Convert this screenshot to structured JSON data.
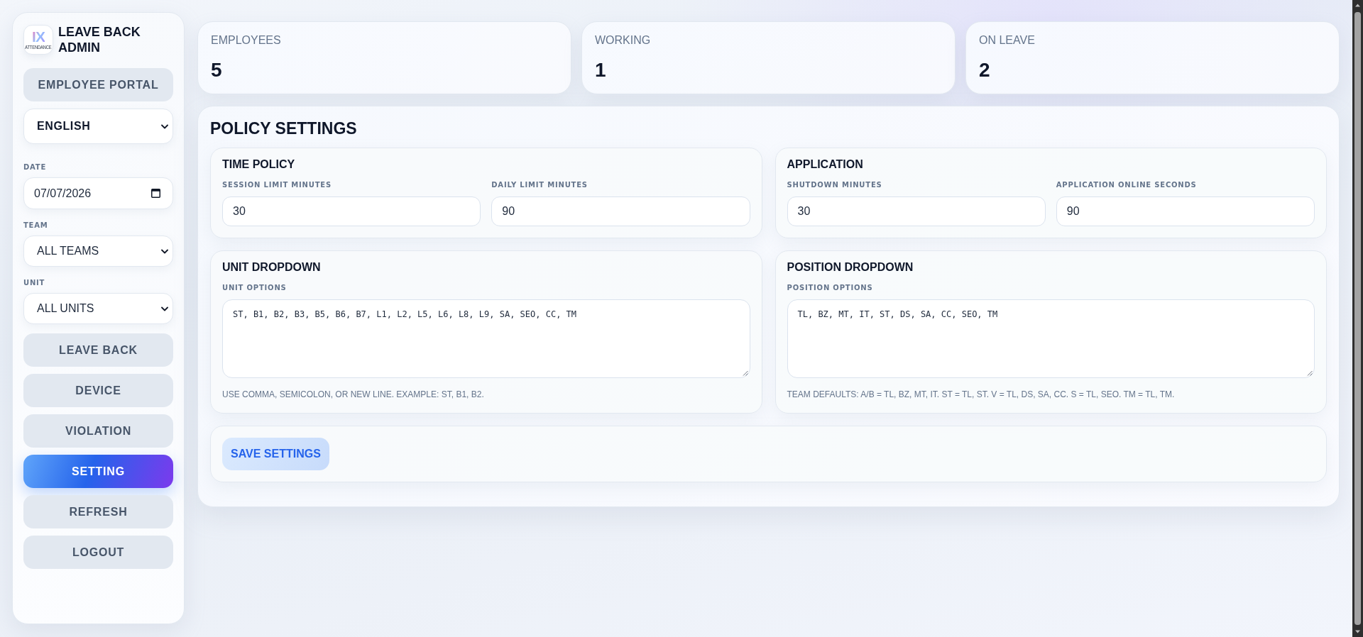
{
  "sidebar": {
    "logo": {
      "mark": "IX",
      "caption": "ATTENDANCE"
    },
    "title": "LEAVE BACK ADMIN",
    "portal_button": "EMPLOYEE PORTAL",
    "language_select": "ENGLISH",
    "filters": [
      {
        "kind": "date",
        "label": "DATE",
        "value": "07/07/2026"
      },
      {
        "kind": "select",
        "label": "TEAM",
        "value": "ALL TEAMS"
      },
      {
        "kind": "select",
        "label": "UNIT",
        "value": "ALL UNITS"
      }
    ],
    "nav": [
      {
        "label": "LEAVE BACK",
        "selected": false
      },
      {
        "label": "DEVICE",
        "selected": false
      },
      {
        "label": "VIOLATION",
        "selected": false
      },
      {
        "label": "SETTING",
        "selected": true
      },
      {
        "label": "REFRESH",
        "selected": false
      },
      {
        "label": "LOGOUT",
        "selected": false
      }
    ]
  },
  "stats": [
    {
      "label": "EMPLOYEES",
      "value": "5"
    },
    {
      "label": "WORKING",
      "value": "1"
    },
    {
      "label": "ON LEAVE",
      "value": "2"
    }
  ],
  "policy": {
    "title": "POLICY SETTINGS",
    "sections": [
      {
        "kind": "fields",
        "title": "TIME POLICY",
        "fields": [
          {
            "label": "SESSION LIMIT MINUTES",
            "value": "30"
          },
          {
            "label": "DAILY LIMIT MINUTES",
            "value": "90"
          }
        ]
      },
      {
        "kind": "fields",
        "title": "APPLICATION",
        "fields": [
          {
            "label": "SHUTDOWN MINUTES",
            "value": "30"
          },
          {
            "label": "APPLICATION ONLINE SECONDS",
            "value": "90"
          }
        ]
      },
      {
        "kind": "options",
        "title": "UNIT DROPDOWN",
        "label": "UNIT OPTIONS",
        "value": "ST, B1, B2, B3, B5, B6, B7, L1, L2, L5, L6, L8, L9, SA, SEO, CC, TM",
        "hint": "USE COMMA, SEMICOLON, OR NEW LINE. EXAMPLE: ST, B1, B2."
      },
      {
        "kind": "options",
        "title": "POSITION DROPDOWN",
        "label": "POSITION OPTIONS",
        "value": "TL, BZ, MT, IT, ST, DS, SA, CC, SEO, TM",
        "hint": "TEAM DEFAULTS: A/B = TL, BZ, MT, IT. ST = TL, ST. V = TL, DS, SA, CC. S = TL, SEO. TM = TL, TM."
      }
    ],
    "save_button": "SAVE SETTINGS"
  }
}
